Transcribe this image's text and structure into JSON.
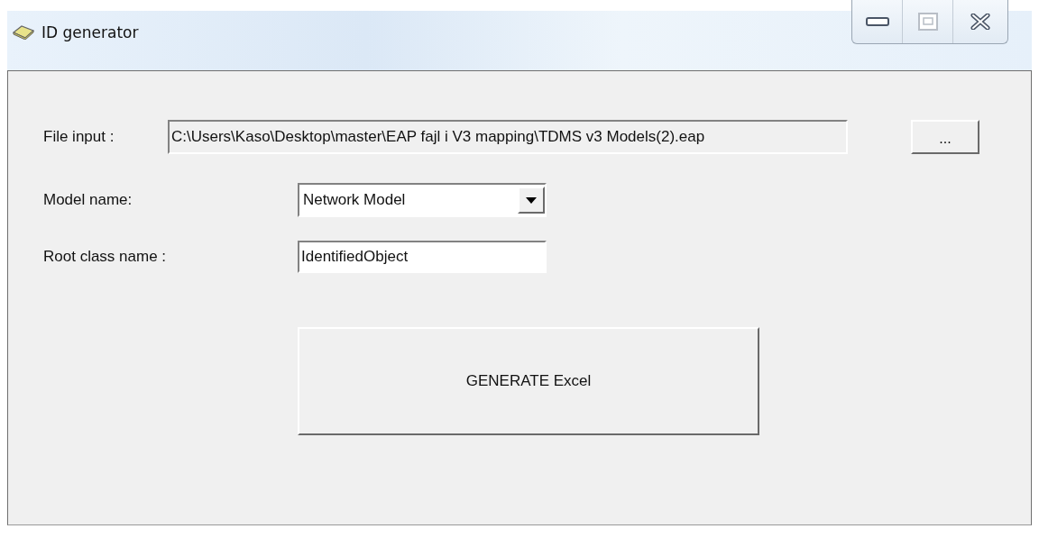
{
  "window": {
    "title": "ID generator",
    "caption_buttons": [
      {
        "kind": "minimize",
        "disabled": false
      },
      {
        "kind": "maximize",
        "disabled": true
      },
      {
        "kind": "close",
        "disabled": false
      }
    ]
  },
  "file_input": {
    "label": "File input :",
    "value": "C:\\Users\\Kaso\\Desktop\\master\\EAP fajl i V3 mapping\\TDMS v3 Models(2).eap",
    "browse_button": "..."
  },
  "model_name": {
    "label": "Model name:",
    "value": "Network Model"
  },
  "root_class_name": {
    "label": "Root class name :",
    "value": "IdentifiedObject"
  },
  "generate_button": "GENERATE Excel"
}
